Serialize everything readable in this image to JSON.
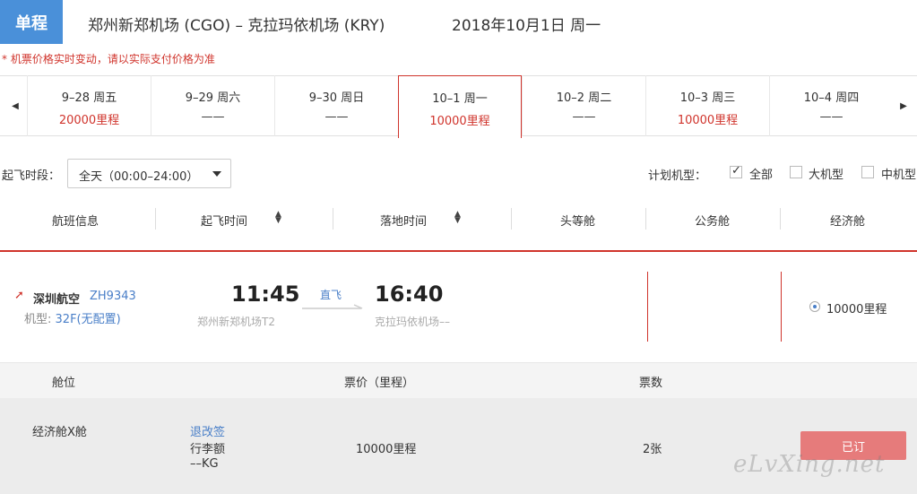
{
  "header": {
    "trip_type": "单程",
    "route": "郑州新郑机场 (CGO) – 克拉玛依机场 (KRY)",
    "date": "2018年10月1日 周一",
    "notice": "* 机票价格实时变动，请以实际支付价格为准"
  },
  "date_strip": {
    "days": [
      {
        "label": "9–28 周五",
        "price": "20000里程"
      },
      {
        "label": "9–29 周六",
        "price": "——"
      },
      {
        "label": "9–30 周日",
        "price": "——"
      },
      {
        "label": "10–1 周一",
        "price": "10000里程",
        "active": true
      },
      {
        "label": "10–2 周二",
        "price": "——"
      },
      {
        "label": "10–3 周三",
        "price": "10000里程"
      },
      {
        "label": "10–4 周四",
        "price": "——"
      }
    ]
  },
  "filters": {
    "time_label": "起飞时段：",
    "time_value": "全天（00:00–24:00）",
    "plan_label": "计划机型：",
    "all_label": "全部",
    "large_label": "大机型",
    "medium_label": "中机型"
  },
  "columns": {
    "flight_info": "航班信息",
    "depart_time": "起飞时间",
    "arrive_time": "落地时间",
    "first_class": "头等舱",
    "business_class": "公务舱",
    "economy_class": "经济舱"
  },
  "flight": {
    "airline": "深圳航空",
    "flight_no": "ZH9343",
    "plane_type_label": "机型:",
    "plane_type_value": "32F(无配置)",
    "depart_time": "11:45",
    "arrive_time": "16:40",
    "direct": "直飞",
    "depart_airport": "郑州新郑机场T2",
    "arrive_airport": "克拉玛依机场––",
    "economy_price": "10000里程"
  },
  "cabin_table": {
    "headers": {
      "cabin": "舱位",
      "price": "票价（里程）",
      "count": "票数"
    },
    "row": {
      "cabin": "经济舱X舱",
      "refund_link": "退改签",
      "baggage_label": "行李额",
      "baggage_value": "––KG",
      "price": "10000里程",
      "count": "2张",
      "book": "已订"
    }
  },
  "watermark": "eLvXing.net",
  "colors": {
    "accent_red": "#d0342c",
    "link_blue": "#4a7fc8",
    "badge_blue": "#4a90d9"
  }
}
